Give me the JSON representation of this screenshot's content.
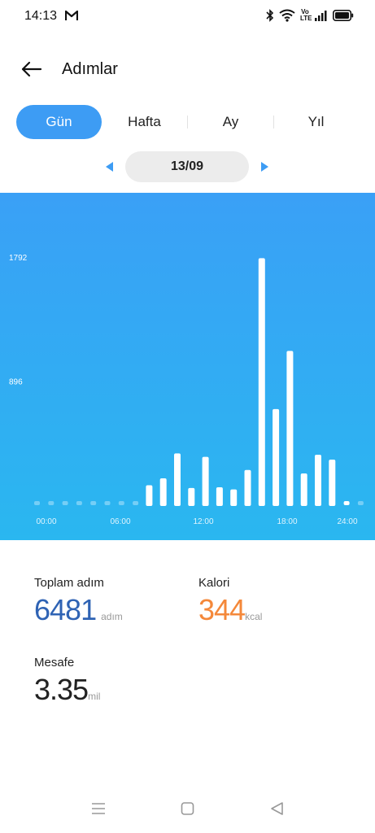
{
  "status_bar": {
    "time": "14:13",
    "volte": "Vo LTE"
  },
  "header": {
    "title": "Adımlar"
  },
  "tabs": [
    {
      "label": "Gün",
      "active": true
    },
    {
      "label": "Hafta",
      "active": false
    },
    {
      "label": "Ay",
      "active": false
    },
    {
      "label": "Yıl",
      "active": false
    }
  ],
  "date_nav": {
    "current": "13/09"
  },
  "chart_data": {
    "type": "bar",
    "y_ticks": [
      "1792",
      "896"
    ],
    "x_ticks": [
      "00:00",
      "06:00",
      "12:00",
      "18:00",
      "24:00"
    ],
    "ylim": [
      0,
      1792
    ],
    "categories": [
      "00:00",
      "01:00",
      "02:00",
      "03:00",
      "04:00",
      "05:00",
      "06:00",
      "07:00",
      "08:00",
      "09:00",
      "10:00",
      "11:00",
      "12:00",
      "13:00",
      "14:00",
      "15:00",
      "16:00",
      "17:00",
      "18:00",
      "19:00",
      "20:00",
      "21:00",
      "22:00",
      "23:00"
    ],
    "values": [
      0,
      0,
      0,
      0,
      0,
      0,
      0,
      0,
      150,
      200,
      380,
      130,
      355,
      135,
      120,
      260,
      1790,
      700,
      1120,
      235,
      370,
      335,
      0,
      0
    ],
    "grid": false,
    "colors": {
      "bar": "#ffffff",
      "background": "#3aa0f6"
    }
  },
  "stats": {
    "total_steps": {
      "label": "Toplam adım",
      "value": "6481",
      "unit": "adım",
      "color": "#2f63b4"
    },
    "calories": {
      "label": "Kalori",
      "value": "344",
      "unit": "kcal",
      "color": "#f4883a"
    },
    "distance": {
      "label": "Mesafe",
      "value": "3.35",
      "unit": "mil",
      "color": "#222222"
    }
  },
  "icons": {
    "back": "arrow-left-icon",
    "prev": "triangle-left-icon",
    "next": "triangle-right-icon",
    "nav_menu": "menu-icon",
    "nav_home": "square-icon",
    "nav_back": "triangle-back-icon"
  }
}
